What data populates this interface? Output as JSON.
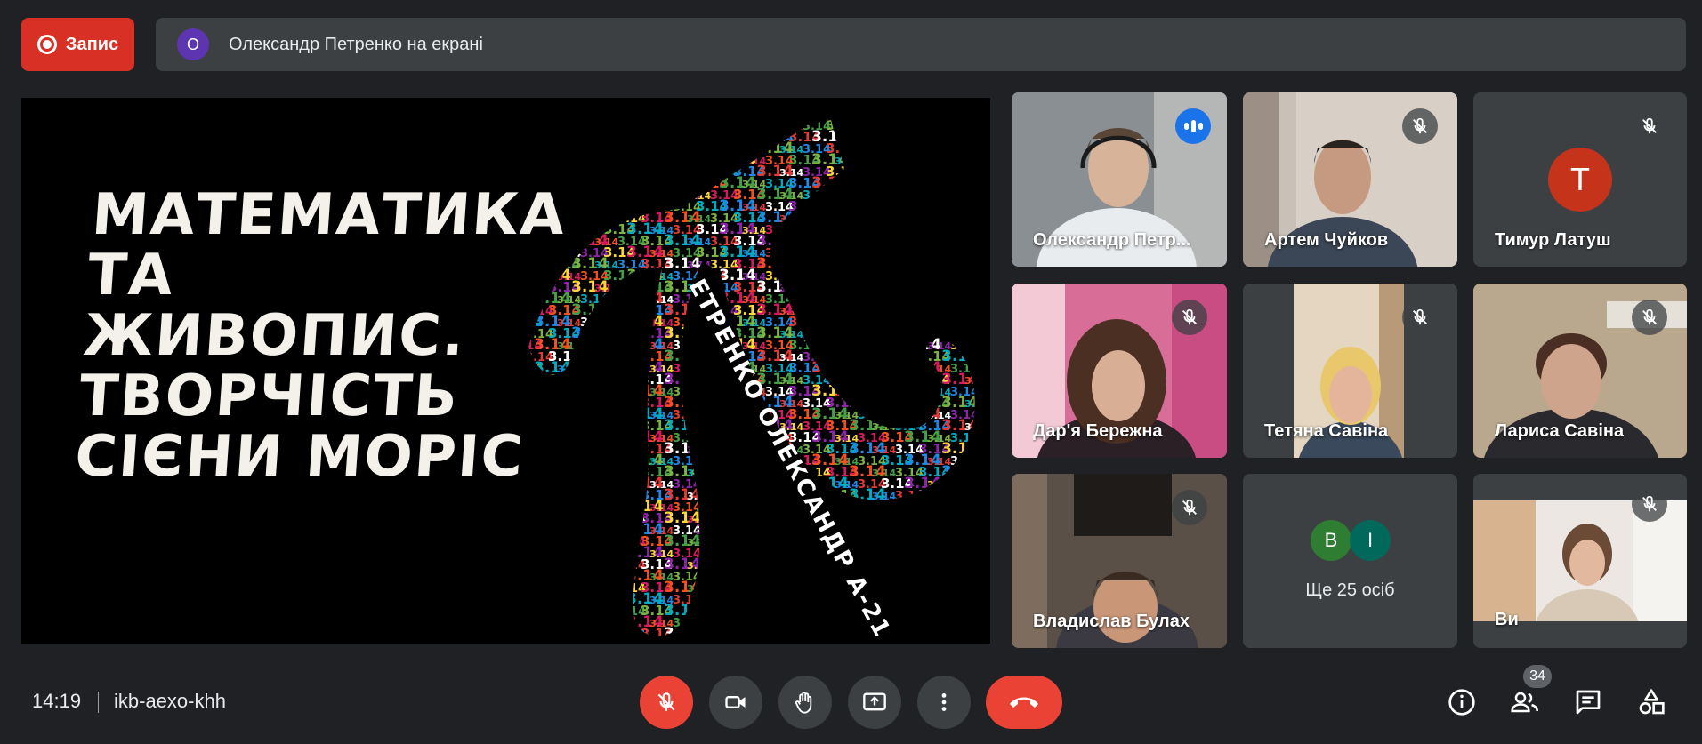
{
  "top_bar": {
    "record_label": "Запис",
    "presenter_initial": "О",
    "presenter_text": "Олександр Петренко на екрані"
  },
  "slide": {
    "title_lines": [
      "Математика та",
      "живопис.",
      "творчість",
      "Сієни Моріс"
    ],
    "author_text": "ЕТРЕНКО ОЛЕКСАНДР А-21",
    "pi_pattern": "3.14"
  },
  "tiles": [
    {
      "name": "Олександр Петр...",
      "active": true,
      "speaking": true
    },
    {
      "name": "Артем Чуйков",
      "muted": true
    },
    {
      "name": "Тимур Латуш",
      "muted": true,
      "avatar_letter": "Т",
      "avatar_color": "#c5341a"
    },
    {
      "name": "Дар'я Бережна",
      "muted": true
    },
    {
      "name": "Тетяна Савіна",
      "muted": true
    },
    {
      "name": "Лариса Савіна",
      "muted": true
    },
    {
      "name": "Владислав Булах",
      "muted": true
    },
    {
      "name": "Ви",
      "muted": true
    }
  ],
  "others": {
    "label": "Ще 25 осіб",
    "avatars": [
      {
        "letter": "В",
        "color": "#2e7d32"
      },
      {
        "letter": "І",
        "color": "#00695c"
      }
    ]
  },
  "bottom_bar": {
    "time": "14:19",
    "meeting_code": "ikb-aexo-khh",
    "participants_count": "34"
  },
  "colors": {
    "background": "#202124",
    "tile": "#3c4043",
    "accent_red": "#ea4335",
    "active_border": "#8ab4f8",
    "speaking_blue": "#1a73e8"
  }
}
